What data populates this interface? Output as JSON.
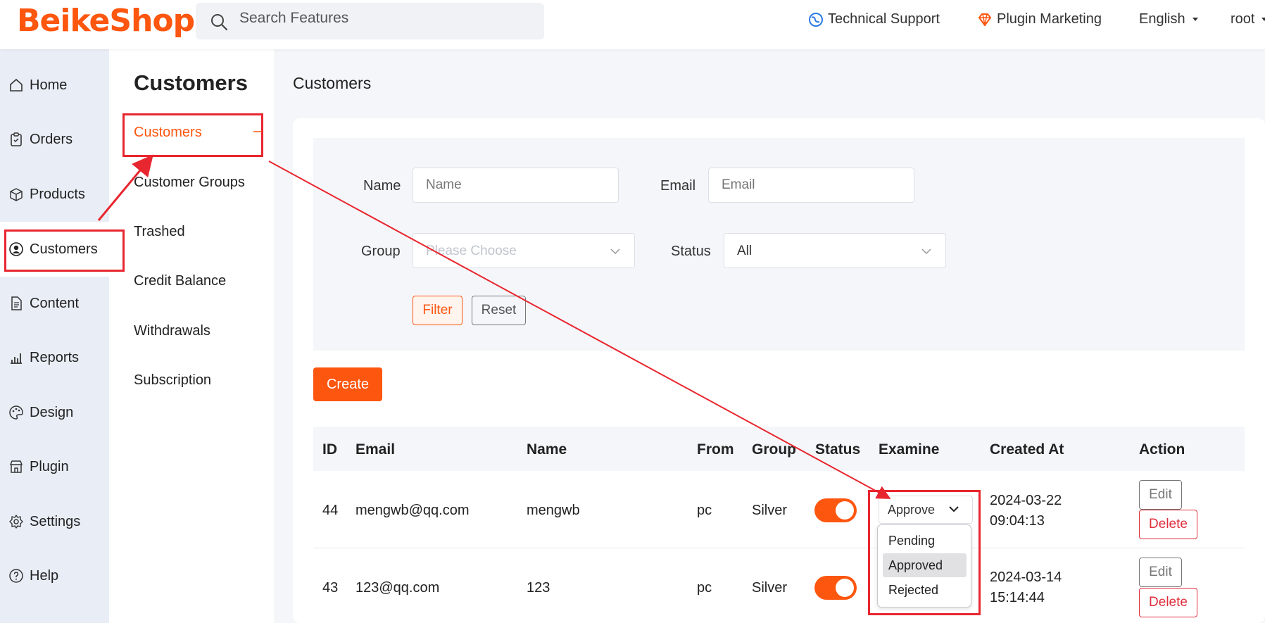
{
  "header": {
    "logo": "BeikeShop",
    "search_placeholder": "Search Features",
    "technical_support": "Technical Support",
    "plugin_marketing": "Plugin Marketing",
    "language": "English",
    "user": "root"
  },
  "sidebar": {
    "items": [
      {
        "label": "Home",
        "icon": "home-icon"
      },
      {
        "label": "Orders",
        "icon": "clipboard-icon"
      },
      {
        "label": "Products",
        "icon": "box-icon"
      },
      {
        "label": "Customers",
        "icon": "user-circle-icon"
      },
      {
        "label": "Content",
        "icon": "document-icon"
      },
      {
        "label": "Reports",
        "icon": "bar-chart-icon"
      },
      {
        "label": "Design",
        "icon": "palette-icon"
      },
      {
        "label": "Plugin",
        "icon": "store-icon"
      },
      {
        "label": "Settings",
        "icon": "gear-icon"
      },
      {
        "label": "Help",
        "icon": "question-icon"
      }
    ]
  },
  "subnav": {
    "title": "Customers",
    "items": [
      {
        "label": "Customers"
      },
      {
        "label": "Customer Groups"
      },
      {
        "label": "Trashed"
      },
      {
        "label": "Credit Balance"
      },
      {
        "label": "Withdrawals"
      },
      {
        "label": "Subscription"
      }
    ]
  },
  "main": {
    "title": "Customers",
    "filter": {
      "name_label": "Name",
      "name_placeholder": "Name",
      "email_label": "Email",
      "email_placeholder": "Email",
      "group_label": "Group",
      "group_placeholder": "Please Choose",
      "status_label": "Status",
      "status_value": "All",
      "filter_button": "Filter",
      "reset_button": "Reset"
    },
    "create_button": "Create",
    "table": {
      "headers": [
        "ID",
        "Email",
        "Name",
        "From",
        "Group",
        "Status",
        "Examine",
        "Created At",
        "Action"
      ],
      "rows": [
        {
          "id": "44",
          "email": "mengwb@qq.com",
          "name": "mengwb",
          "from": "pc",
          "group": "Silver",
          "created_date": "2024-03-22",
          "created_time": "09:04:13"
        },
        {
          "id": "43",
          "email": "123@qq.com",
          "name": "123",
          "from": "pc",
          "group": "Silver",
          "created_date": "2024-03-14",
          "created_time": "15:14:44"
        }
      ],
      "edit_label": "Edit",
      "delete_label": "Delete"
    },
    "examine_select": {
      "value": "Approve",
      "options": [
        "Pending",
        "Approved",
        "Rejected"
      ],
      "highlighted": "Approved"
    }
  },
  "colors": {
    "accent": "#fd560f",
    "annotation": "#e8262f",
    "danger": "#e02d3c"
  }
}
